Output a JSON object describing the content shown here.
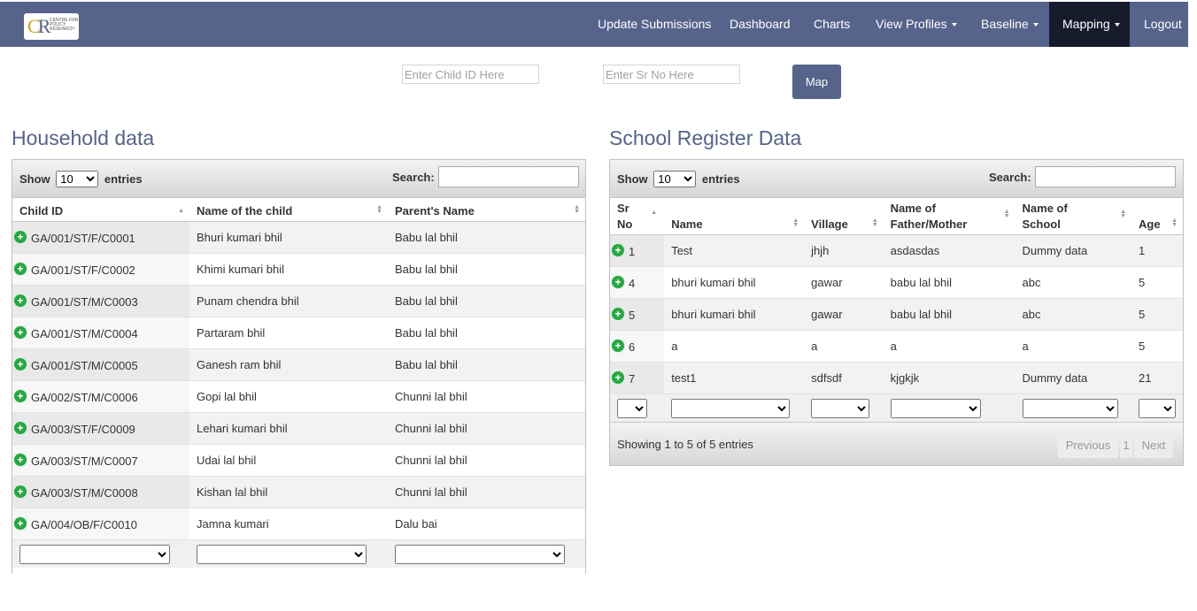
{
  "nav": {
    "logo_text": "CPR CENTRE FOR POLICY RESEARCH",
    "items": [
      {
        "label": "Update Submissions",
        "dropdown": false
      },
      {
        "label": "Dashboard",
        "dropdown": false
      },
      {
        "label": "Charts",
        "dropdown": false
      },
      {
        "label": "View Profiles",
        "dropdown": true
      },
      {
        "label": "Baseline",
        "dropdown": true
      },
      {
        "label": "Mapping",
        "dropdown": true,
        "active": true
      },
      {
        "label": "Logout",
        "dropdown": false
      }
    ]
  },
  "mapping_form": {
    "child_id_placeholder": "Enter Child ID Here",
    "sr_no_placeholder": "Enter Sr No Here",
    "map_label": "Map"
  },
  "household": {
    "title": "Household data",
    "show_label": "Show",
    "entries_value": "10",
    "entries_label": "entries",
    "search_label": "Search:",
    "columns": [
      "Child ID",
      "Name of the child",
      "Parent's Name"
    ],
    "rows": [
      [
        "GA/001/ST/F/C0001",
        "Bhuri kumari bhil",
        "Babu lal bhil"
      ],
      [
        "GA/001/ST/F/C0002",
        "Khimi kumari bhil",
        "Babu lal bhil"
      ],
      [
        "GA/001/ST/M/C0003",
        "Punam chendra bhil",
        "Babu lal bhil"
      ],
      [
        "GA/001/ST/M/C0004",
        "Partaram bhil",
        "Babu lal bhil"
      ],
      [
        "GA/001/ST/M/C0005",
        "Ganesh ram bhil",
        "Babu lal bhil"
      ],
      [
        "GA/002/ST/M/C0006",
        "Gopi lal bhil",
        "Chunni lal bhil"
      ],
      [
        "GA/003/ST/F/C0009",
        "Lehari kumari bhil",
        "Chunni lal bhil"
      ],
      [
        "GA/003/ST/M/C0007",
        "Udai lal bhil",
        "Chunni lal bhil"
      ],
      [
        "GA/003/ST/M/C0008",
        "Kishan lal bhil",
        "Chunni lal bhil"
      ],
      [
        "GA/004/OB/F/C0010",
        "Jamna kumari",
        "Dalu bai"
      ]
    ]
  },
  "school": {
    "title": "School Register Data",
    "show_label": "Show",
    "entries_value": "10",
    "entries_label": "entries",
    "search_label": "Search:",
    "columns": [
      {
        "line1": "Sr",
        "line2": "No"
      },
      {
        "line1": "",
        "line2": "Name"
      },
      {
        "line1": "",
        "line2": "Village"
      },
      {
        "line1": "Name of",
        "line2": "Father/Mother"
      },
      {
        "line1": "Name of",
        "line2": "School"
      },
      {
        "line1": "",
        "line2": "Age"
      }
    ],
    "rows": [
      [
        "1",
        "Test",
        "jhjh",
        "asdasdas",
        "Dummy data",
        "1"
      ],
      [
        "4",
        "bhuri kumari bhil",
        "gawar",
        "babu lal bhil",
        "abc",
        "5"
      ],
      [
        "5",
        "bhuri kumari bhil",
        "gawar",
        "babu lal bhil",
        "abc",
        "5"
      ],
      [
        "6",
        "a",
        "a",
        "a",
        "a",
        "5"
      ],
      [
        "7",
        "test1",
        "sdfsdf",
        "kjgkjk",
        "Dummy data",
        "21"
      ]
    ],
    "info": "Showing 1 to 5 of 5 entries",
    "pagination": {
      "previous": "Previous",
      "page": "1",
      "next": "Next"
    }
  },
  "colors": {
    "navbar": "#56638a",
    "nav_active": "#161c2b",
    "title": "#56638a",
    "expand_icon": "#28a745"
  }
}
